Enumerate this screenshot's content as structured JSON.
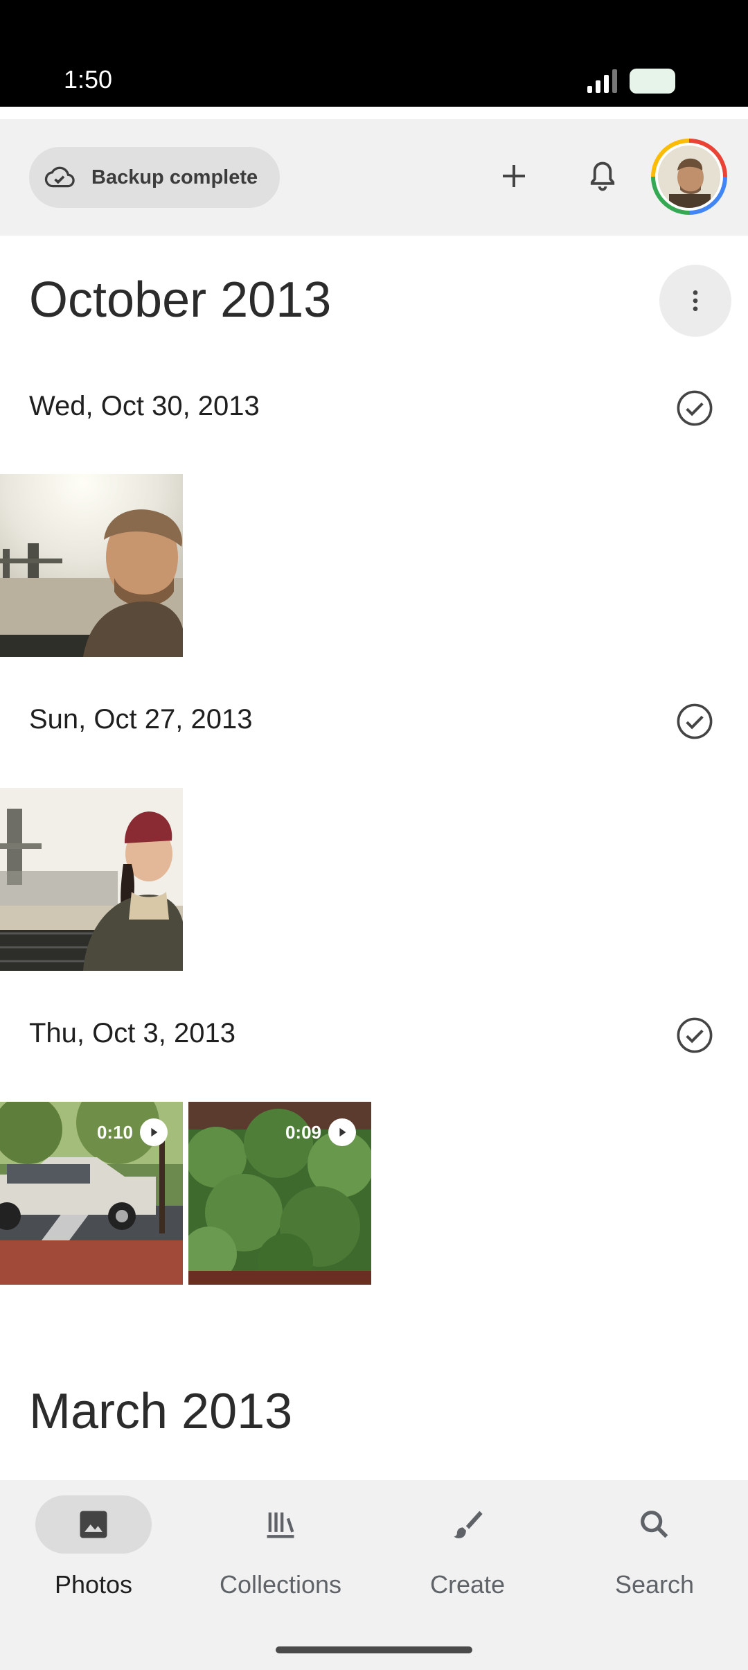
{
  "status_bar": {
    "time": "1:50"
  },
  "header": {
    "backup_label": "Backup complete",
    "icons": [
      "cloud-check-icon",
      "add-icon",
      "bell-icon",
      "account-avatar"
    ],
    "avatar_ring_colors": [
      "#ea4335",
      "#4285f4",
      "#34a853",
      "#fbbc05"
    ]
  },
  "sections": [
    {
      "month": "October 2013",
      "days": [
        {
          "date": "Wed, Oct 30, 2013",
          "items": [
            {
              "kind": "photo",
              "subject": "selfie-tower-bridge"
            }
          ]
        },
        {
          "date": "Sun, Oct 27, 2013",
          "items": [
            {
              "kind": "photo",
              "subject": "woman-tower-bridge"
            }
          ]
        },
        {
          "date": "Thu, Oct 3, 2013",
          "items": [
            {
              "kind": "video",
              "duration": "0:10",
              "subject": "car-street"
            },
            {
              "kind": "video",
              "duration": "0:09",
              "subject": "green-bush"
            }
          ]
        }
      ]
    },
    {
      "month": "March 2013"
    }
  ],
  "bottom_nav": {
    "items": [
      {
        "label": "Photos",
        "icon": "image-icon",
        "active": true
      },
      {
        "label": "Collections",
        "icon": "collections-icon",
        "active": false
      },
      {
        "label": "Create",
        "icon": "brush-icon",
        "active": false
      },
      {
        "label": "Search",
        "icon": "search-icon",
        "active": false
      }
    ]
  },
  "colors": {
    "accent_bg": "#f1f1f1",
    "chip_bg": "#e0e0e0",
    "text": "#1f1f1f"
  }
}
